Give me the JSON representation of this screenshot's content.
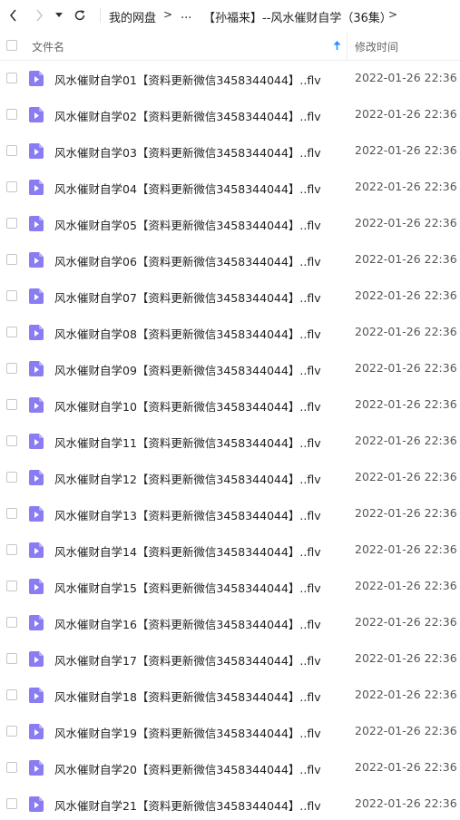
{
  "toolbar": {
    "breadcrumb": {
      "root": "我的网盘",
      "sep1": ">",
      "ellipsis": "...",
      "folder": "【孙福来】--风水催财自学（36集）",
      "sep2": ">"
    }
  },
  "header": {
    "name_col": "文件名",
    "date_col": "修改时间",
    "sort_icon": "sort-ascending-icon",
    "accent_color": "#2a8ff7"
  },
  "files": [
    {
      "name": "风水催财自学01【资料更新微信3458344044】..flv",
      "date": "2022-01-26 22:36"
    },
    {
      "name": "风水催财自学02【资料更新微信3458344044】..flv",
      "date": "2022-01-26 22:36"
    },
    {
      "name": "风水催财自学03【资料更新微信3458344044】..flv",
      "date": "2022-01-26 22:36"
    },
    {
      "name": "风水催财自学04【资料更新微信3458344044】..flv",
      "date": "2022-01-26 22:36"
    },
    {
      "name": "风水催财自学05【资料更新微信3458344044】..flv",
      "date": "2022-01-26 22:36"
    },
    {
      "name": "风水催财自学06【资料更新微信3458344044】..flv",
      "date": "2022-01-26 22:36"
    },
    {
      "name": "风水催财自学07【资料更新微信3458344044】..flv",
      "date": "2022-01-26 22:36"
    },
    {
      "name": "风水催财自学08【资料更新微信3458344044】..flv",
      "date": "2022-01-26 22:36"
    },
    {
      "name": "风水催财自学09【资料更新微信3458344044】..flv",
      "date": "2022-01-26 22:36"
    },
    {
      "name": "风水催财自学10【资料更新微信3458344044】..flv",
      "date": "2022-01-26 22:36"
    },
    {
      "name": "风水催财自学11【资料更新微信3458344044】..flv",
      "date": "2022-01-26 22:36"
    },
    {
      "name": "风水催财自学12【资料更新微信3458344044】..flv",
      "date": "2022-01-26 22:36"
    },
    {
      "name": "风水催财自学13【资料更新微信3458344044】..flv",
      "date": "2022-01-26 22:36"
    },
    {
      "name": "风水催财自学14【资料更新微信3458344044】..flv",
      "date": "2022-01-26 22:36"
    },
    {
      "name": "风水催财自学15【资料更新微信3458344044】..flv",
      "date": "2022-01-26 22:36"
    },
    {
      "name": "风水催财自学16【资料更新微信3458344044】..flv",
      "date": "2022-01-26 22:36"
    },
    {
      "name": "风水催财自学17【资料更新微信3458344044】..flv",
      "date": "2022-01-26 22:36"
    },
    {
      "name": "风水催财自学18【资料更新微信3458344044】..flv",
      "date": "2022-01-26 22:36"
    },
    {
      "name": "风水催财自学19【资料更新微信3458344044】..flv",
      "date": "2022-01-26 22:36"
    },
    {
      "name": "风水催财自学20【资料更新微信3458344044】..flv",
      "date": "2022-01-26 22:36"
    },
    {
      "name": "风水催财自学21【资料更新微信3458344044】..flv",
      "date": "2022-01-26 22:36"
    }
  ],
  "file_icon": "video-file-icon",
  "file_icon_color": "#8a7cf2"
}
